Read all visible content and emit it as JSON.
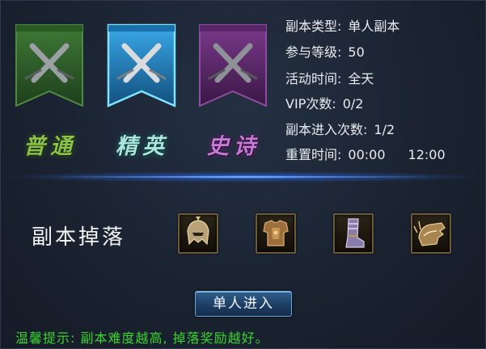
{
  "difficulties": [
    {
      "label": "普通",
      "color": "#8cc24a",
      "icon": "crossed-swords-icon",
      "banner_color": "#2d5a28"
    },
    {
      "label": "精英",
      "color": "#a8e6e0",
      "icon": "crossed-swords-icon",
      "banner_color": "#1f7fb8"
    },
    {
      "label": "史诗",
      "color": "#c77ad8",
      "icon": "crossed-swords-icon",
      "banner_color": "#5a2a68"
    }
  ],
  "info": {
    "type_label": "副本类型:",
    "type_value": "单人副本",
    "level_label": "参与等级:",
    "level_value": "50",
    "time_label": "活动时间:",
    "time_value": "全天",
    "vip_label": "VIP次数:",
    "vip_value": "0/2",
    "entries_label": "副本进入次数:",
    "entries_value": "1/2",
    "reset_label": "重置时间:",
    "reset_value_1": "00:00",
    "reset_value_2": "12:00"
  },
  "drops": {
    "title": "副本掉落",
    "items": [
      {
        "icon": "helmet-icon"
      },
      {
        "icon": "chest-armor-icon"
      },
      {
        "icon": "boots-icon"
      },
      {
        "icon": "gauntlet-icon"
      }
    ]
  },
  "enter_button": "单人进入",
  "tip": "温馨提示: 副本难度越高, 掉落奖励越好。",
  "colors": {
    "tip": "#39d42f",
    "button": "#2f5f8c",
    "divider_glow": "#6aa8ff"
  }
}
